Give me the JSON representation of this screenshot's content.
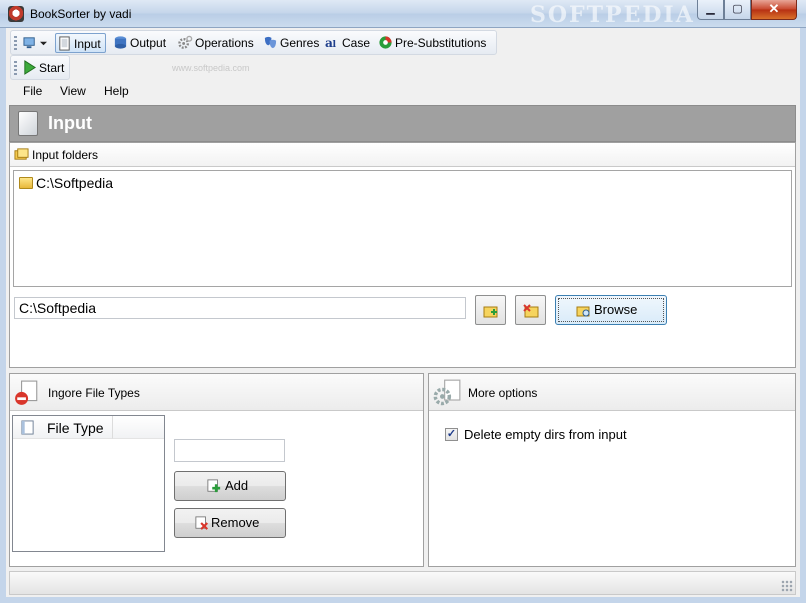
{
  "window": {
    "title": "BookSorter by vadi",
    "watermark": "SOFTPEDIA",
    "min_glyph": "▁",
    "max_glyph": "▢",
    "close_glyph": "✕"
  },
  "toolbar": {
    "items": [
      {
        "label": "Input"
      },
      {
        "label": "Output"
      },
      {
        "label": "Operations"
      },
      {
        "label": "Genres"
      },
      {
        "label": "Case"
      },
      {
        "label": "Pre-Substitutions"
      }
    ],
    "start_label": "Start",
    "watermark_url": "www.softpedia.com"
  },
  "menu": {
    "items": [
      "File",
      "View",
      "Help"
    ]
  },
  "section": {
    "title": "Input"
  },
  "input_folders": {
    "heading": "Input folders",
    "folders": [
      "C:\\Softpedia"
    ],
    "path_value": "C:\\Softpedia",
    "browse_label": "Browse"
  },
  "ignore_file_types": {
    "heading": "Ingore File Types",
    "column_header": "File Type",
    "add_label": "Add",
    "remove_label": "Remove"
  },
  "more_options": {
    "heading": "More options",
    "delete_empty_dirs_label": "Delete empty dirs from input",
    "delete_empty_dirs_checked": true,
    "check_glyph": "✓"
  },
  "colors": {
    "header_bg": "#a0a0a0",
    "accent_blue": "#3c7fb1",
    "close_red": "#c7452b"
  }
}
